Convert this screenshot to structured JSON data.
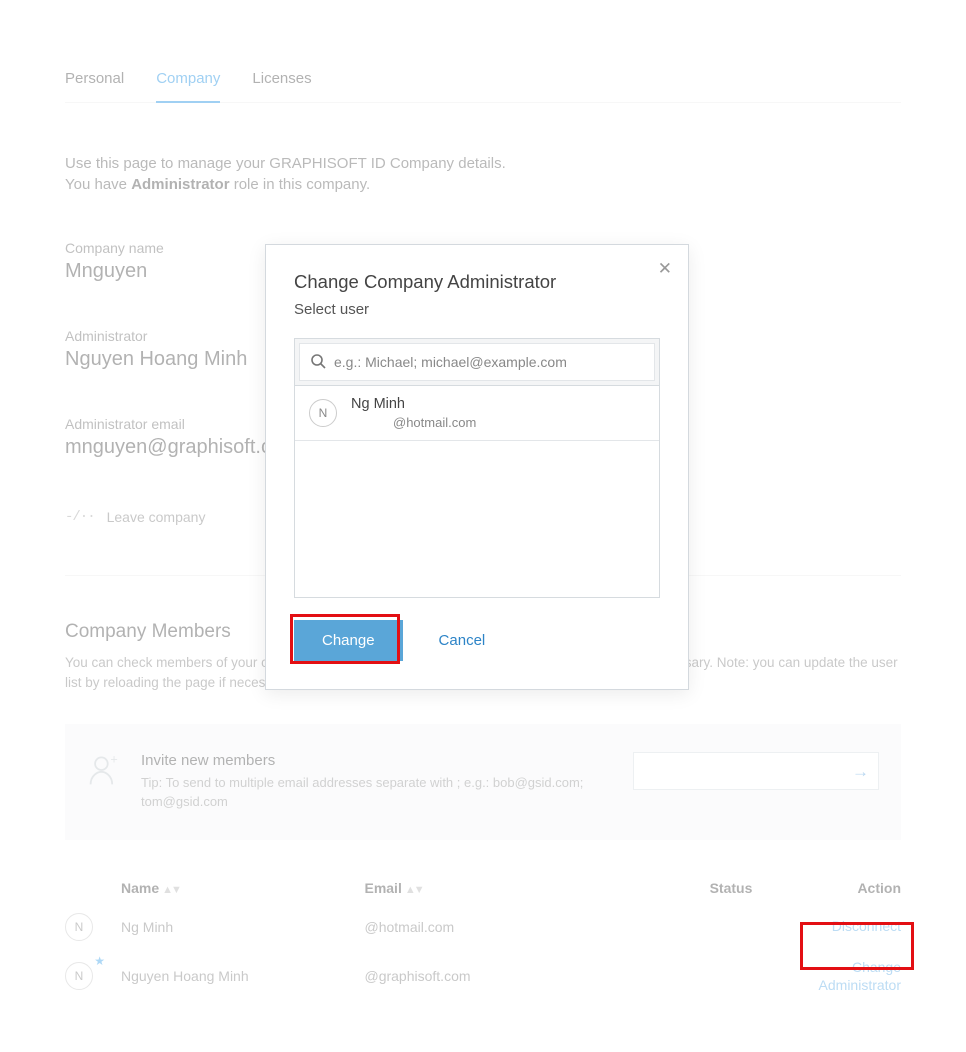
{
  "tabs": {
    "personal": "Personal",
    "company": "Company",
    "licenses": "Licenses"
  },
  "intro": {
    "line1": "Use this page to manage your GRAPHISOFT ID Company details.",
    "line2a": "You have ",
    "role": "Administrator",
    "line2b": " role in this company."
  },
  "company_name": {
    "label": "Company name",
    "value": "Mnguyen"
  },
  "admin_name": {
    "label": "Administrator",
    "value": "Nguyen Hoang Minh"
  },
  "admin_email": {
    "label": "Administrator email",
    "value": "mnguyen@graphisoft.com"
  },
  "leave_label": "Leave company",
  "members": {
    "heading": "Company Members",
    "desc": "You can check members of your company, invite new members and remove existing members as necessary. Note: you can update the user list by reloading the page if necessary.",
    "invite": {
      "title": "Invite new members",
      "tip": "Tip: To send to multiple email addresses separate with ; e.g.: bob@gsid.com; tom@gsid.com"
    },
    "columns": {
      "name": "Name",
      "email": "Email",
      "status": "Status",
      "action": "Action"
    },
    "rows": [
      {
        "initial": "N",
        "name": "Ng Minh",
        "email": "@hotmail.com",
        "status": "",
        "action": "Disconnect",
        "star": false
      },
      {
        "initial": "N",
        "name": "Nguyen Hoang Minh",
        "email": "@graphisoft.com",
        "status": "",
        "action": "Change Administrator",
        "star": true
      }
    ]
  },
  "modal": {
    "title": "Change Company Administrator",
    "subtitle": "Select user",
    "search_placeholder": "e.g.: Michael; michael@example.com",
    "user": {
      "initial": "N",
      "name": "Ng Minh",
      "email": "@hotmail.com"
    },
    "change_btn": "Change",
    "cancel_btn": "Cancel"
  }
}
